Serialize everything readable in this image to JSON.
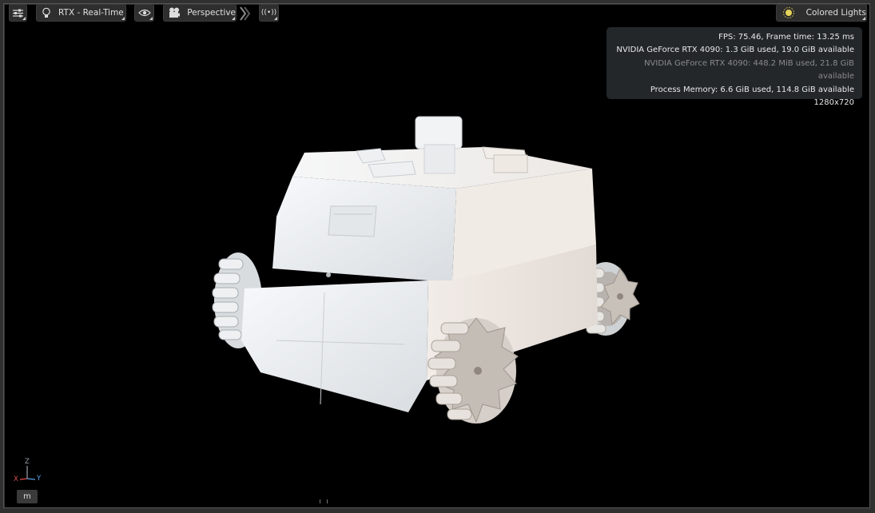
{
  "toolbar": {
    "settings_icon": "sliders-icon",
    "renderer_icon": "lightbulb-icon",
    "renderer_label": "RTX - Real-Time",
    "visibility_icon": "eye-icon",
    "camera_icon": "movie-camera-icon",
    "camera_label": "Perspective",
    "expand_icon": "chevron-right-double-icon",
    "broadcast_icon": "broadcast-icon",
    "broadcast_label": "((•))",
    "lighting_icon": "sun-icon",
    "lighting_label": "Colored Lights"
  },
  "stats": {
    "fps": "FPS: 75.46, Frame time: 13.25 ms",
    "gpu0": "NVIDIA GeForce RTX 4090: 1.3 GiB used, 19.0 GiB available",
    "gpu1": "NVIDIA GeForce RTX 4090: 448.2 MiB used, 21.8 GiB available",
    "process": "Process Memory: 6.6 GiB used, 114.8 GiB available",
    "resolution": "1280x720"
  },
  "axis": {
    "z": "Z",
    "x": "X",
    "y": "Y"
  },
  "units_label": "m",
  "colors": {
    "viewport_bg": "#000000",
    "panel_bg": "#262a2e",
    "axis_x": "#e05050",
    "axis_y": "#5aa0e8",
    "axis_z": "#9aa0a6",
    "model": "#eef0f2"
  }
}
